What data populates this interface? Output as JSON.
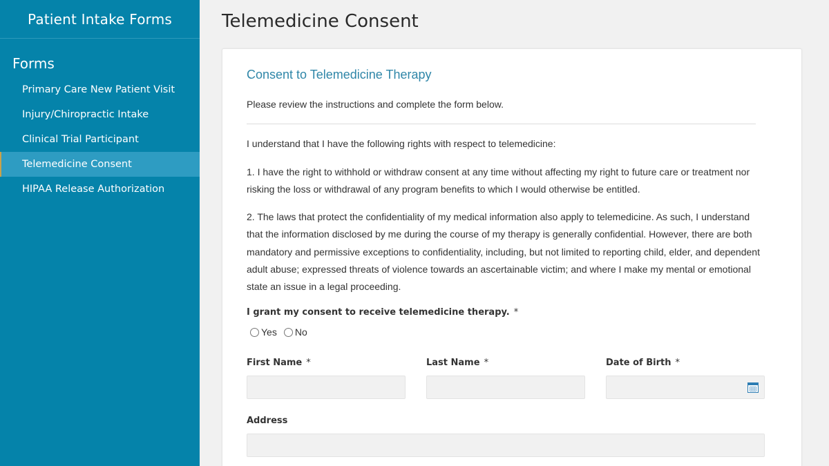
{
  "app": {
    "title": "Patient Intake Forms"
  },
  "sidebar": {
    "heading": "Forms",
    "items": [
      {
        "label": "Primary Care New Patient Visit"
      },
      {
        "label": "Injury/Chiropractic Intake"
      },
      {
        "label": "Clinical Trial Participant"
      },
      {
        "label": "Telemedicine Consent",
        "active": true
      },
      {
        "label": "HIPAA Release Authorization"
      }
    ]
  },
  "page": {
    "title": "Telemedicine Consent"
  },
  "form": {
    "title": "Consent to Telemedicine Therapy",
    "instructions": "Please review the instructions and complete the form below.",
    "paragraphs": [
      "I understand that I have the following rights with respect to telemedicine:",
      "1. I have the right to withhold or withdraw consent at any time without affecting my right to future care or treatment nor risking the loss or withdrawal of any program benefits to which I would otherwise be entitled.",
      "2. The laws that protect the confidentiality of my medical information also apply to telemedicine. As such, I understand that the information disclosed by me during the course of my therapy is generally confidential. However, there are both mandatory and permissive exceptions to confidentiality, including, but not limited to reporting child, elder, and dependent adult abuse; expressed threats of violence towards an ascertainable victim; and where I make my mental or emotional state an issue in a legal proceeding."
    ],
    "consent_question": "I grant my consent to receive telemedicine therapy.",
    "required_marker": "*",
    "options": {
      "yes": "Yes",
      "no": "No"
    },
    "fields": {
      "first_name": {
        "label": "First Name",
        "value": ""
      },
      "last_name": {
        "label": "Last Name",
        "value": ""
      },
      "dob": {
        "label": "Date of Birth",
        "value": ""
      },
      "address": {
        "label": "Address",
        "value": ""
      }
    }
  },
  "colors": {
    "sidebar_bg": "#0583aa",
    "sidebar_active_bg": "#2e9cc2",
    "form_title": "#2f86a8",
    "input_bg": "#f1f1f1"
  }
}
